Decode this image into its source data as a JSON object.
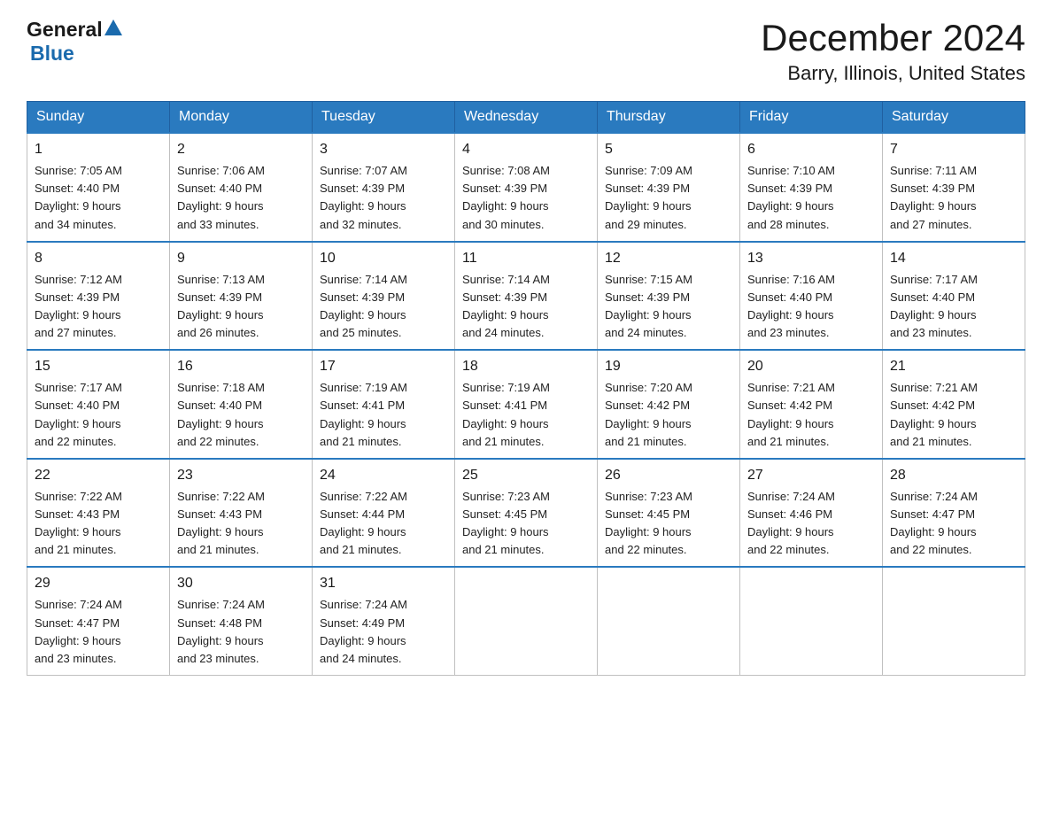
{
  "header": {
    "logo_general": "General",
    "logo_blue": "Blue",
    "title": "December 2024",
    "subtitle": "Barry, Illinois, United States"
  },
  "calendar": {
    "days_of_week": [
      "Sunday",
      "Monday",
      "Tuesday",
      "Wednesday",
      "Thursday",
      "Friday",
      "Saturday"
    ],
    "weeks": [
      [
        {
          "day": "1",
          "sunrise": "7:05 AM",
          "sunset": "4:40 PM",
          "daylight": "9 hours and 34 minutes."
        },
        {
          "day": "2",
          "sunrise": "7:06 AM",
          "sunset": "4:40 PM",
          "daylight": "9 hours and 33 minutes."
        },
        {
          "day": "3",
          "sunrise": "7:07 AM",
          "sunset": "4:39 PM",
          "daylight": "9 hours and 32 minutes."
        },
        {
          "day": "4",
          "sunrise": "7:08 AM",
          "sunset": "4:39 PM",
          "daylight": "9 hours and 30 minutes."
        },
        {
          "day": "5",
          "sunrise": "7:09 AM",
          "sunset": "4:39 PM",
          "daylight": "9 hours and 29 minutes."
        },
        {
          "day": "6",
          "sunrise": "7:10 AM",
          "sunset": "4:39 PM",
          "daylight": "9 hours and 28 minutes."
        },
        {
          "day": "7",
          "sunrise": "7:11 AM",
          "sunset": "4:39 PM",
          "daylight": "9 hours and 27 minutes."
        }
      ],
      [
        {
          "day": "8",
          "sunrise": "7:12 AM",
          "sunset": "4:39 PM",
          "daylight": "9 hours and 27 minutes."
        },
        {
          "day": "9",
          "sunrise": "7:13 AM",
          "sunset": "4:39 PM",
          "daylight": "9 hours and 26 minutes."
        },
        {
          "day": "10",
          "sunrise": "7:14 AM",
          "sunset": "4:39 PM",
          "daylight": "9 hours and 25 minutes."
        },
        {
          "day": "11",
          "sunrise": "7:14 AM",
          "sunset": "4:39 PM",
          "daylight": "9 hours and 24 minutes."
        },
        {
          "day": "12",
          "sunrise": "7:15 AM",
          "sunset": "4:39 PM",
          "daylight": "9 hours and 24 minutes."
        },
        {
          "day": "13",
          "sunrise": "7:16 AM",
          "sunset": "4:40 PM",
          "daylight": "9 hours and 23 minutes."
        },
        {
          "day": "14",
          "sunrise": "7:17 AM",
          "sunset": "4:40 PM",
          "daylight": "9 hours and 23 minutes."
        }
      ],
      [
        {
          "day": "15",
          "sunrise": "7:17 AM",
          "sunset": "4:40 PM",
          "daylight": "9 hours and 22 minutes."
        },
        {
          "day": "16",
          "sunrise": "7:18 AM",
          "sunset": "4:40 PM",
          "daylight": "9 hours and 22 minutes."
        },
        {
          "day": "17",
          "sunrise": "7:19 AM",
          "sunset": "4:41 PM",
          "daylight": "9 hours and 21 minutes."
        },
        {
          "day": "18",
          "sunrise": "7:19 AM",
          "sunset": "4:41 PM",
          "daylight": "9 hours and 21 minutes."
        },
        {
          "day": "19",
          "sunrise": "7:20 AM",
          "sunset": "4:42 PM",
          "daylight": "9 hours and 21 minutes."
        },
        {
          "day": "20",
          "sunrise": "7:21 AM",
          "sunset": "4:42 PM",
          "daylight": "9 hours and 21 minutes."
        },
        {
          "day": "21",
          "sunrise": "7:21 AM",
          "sunset": "4:42 PM",
          "daylight": "9 hours and 21 minutes."
        }
      ],
      [
        {
          "day": "22",
          "sunrise": "7:22 AM",
          "sunset": "4:43 PM",
          "daylight": "9 hours and 21 minutes."
        },
        {
          "day": "23",
          "sunrise": "7:22 AM",
          "sunset": "4:43 PM",
          "daylight": "9 hours and 21 minutes."
        },
        {
          "day": "24",
          "sunrise": "7:22 AM",
          "sunset": "4:44 PM",
          "daylight": "9 hours and 21 minutes."
        },
        {
          "day": "25",
          "sunrise": "7:23 AM",
          "sunset": "4:45 PM",
          "daylight": "9 hours and 21 minutes."
        },
        {
          "day": "26",
          "sunrise": "7:23 AM",
          "sunset": "4:45 PM",
          "daylight": "9 hours and 22 minutes."
        },
        {
          "day": "27",
          "sunrise": "7:24 AM",
          "sunset": "4:46 PM",
          "daylight": "9 hours and 22 minutes."
        },
        {
          "day": "28",
          "sunrise": "7:24 AM",
          "sunset": "4:47 PM",
          "daylight": "9 hours and 22 minutes."
        }
      ],
      [
        {
          "day": "29",
          "sunrise": "7:24 AM",
          "sunset": "4:47 PM",
          "daylight": "9 hours and 23 minutes."
        },
        {
          "day": "30",
          "sunrise": "7:24 AM",
          "sunset": "4:48 PM",
          "daylight": "9 hours and 23 minutes."
        },
        {
          "day": "31",
          "sunrise": "7:24 AM",
          "sunset": "4:49 PM",
          "daylight": "9 hours and 24 minutes."
        },
        null,
        null,
        null,
        null
      ]
    ]
  }
}
